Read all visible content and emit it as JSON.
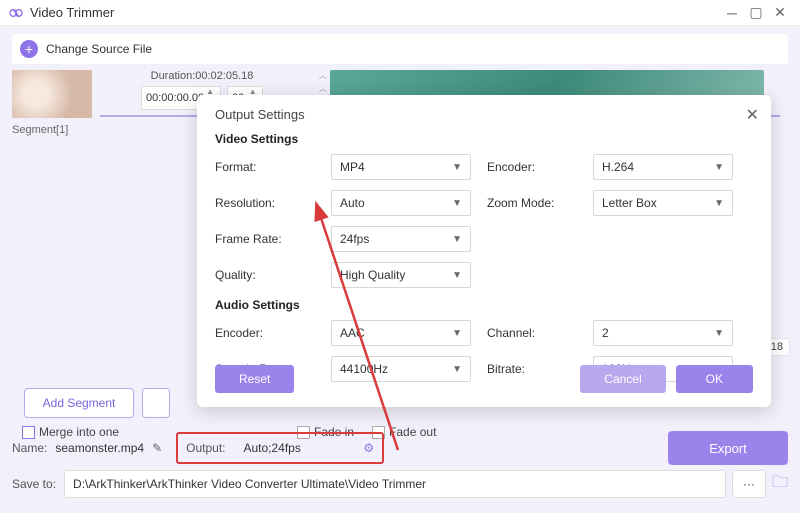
{
  "window": {
    "title": "Video Trimmer"
  },
  "toolbar": {
    "change_source": "Change Source File"
  },
  "timeline": {
    "duration_label": "Duration:00:02:05.18",
    "start_time": "00:00:00.00",
    "end_time": "00:",
    "segment_label": "Segment[1]",
    "right_timestamp": ".18"
  },
  "segment": {
    "add_label": "Add Segment",
    "merge_label": "Merge into one",
    "fade_in_label": "Fade in",
    "fade_out_label": "Fade out"
  },
  "file": {
    "name_label": "Name:",
    "name_value": "seamonster.mp4",
    "output_label": "Output:",
    "output_value": "Auto;24fps",
    "export_label": "Export",
    "save_label": "Save to:",
    "save_path": "D:\\ArkThinker\\ArkThinker Video Converter Ultimate\\Video Trimmer"
  },
  "modal": {
    "title": "Output Settings",
    "video_h": "Video Settings",
    "audio_h": "Audio Settings",
    "labels": {
      "format": "Format:",
      "encoder": "Encoder:",
      "resolution": "Resolution:",
      "zoom": "Zoom Mode:",
      "frame_rate": "Frame Rate:",
      "quality": "Quality:",
      "a_encoder": "Encoder:",
      "channel": "Channel:",
      "sample_rate": "Sample Rate:",
      "bitrate": "Bitrate:"
    },
    "values": {
      "format": "MP4",
      "encoder": "H.264",
      "resolution": "Auto",
      "zoom": "Letter Box",
      "frame_rate": "24fps",
      "quality": "High Quality",
      "a_encoder": "AAC",
      "channel": "2",
      "sample_rate": "44100Hz",
      "bitrate": "192kbps"
    },
    "buttons": {
      "reset": "Reset",
      "cancel": "Cancel",
      "ok": "OK"
    }
  }
}
